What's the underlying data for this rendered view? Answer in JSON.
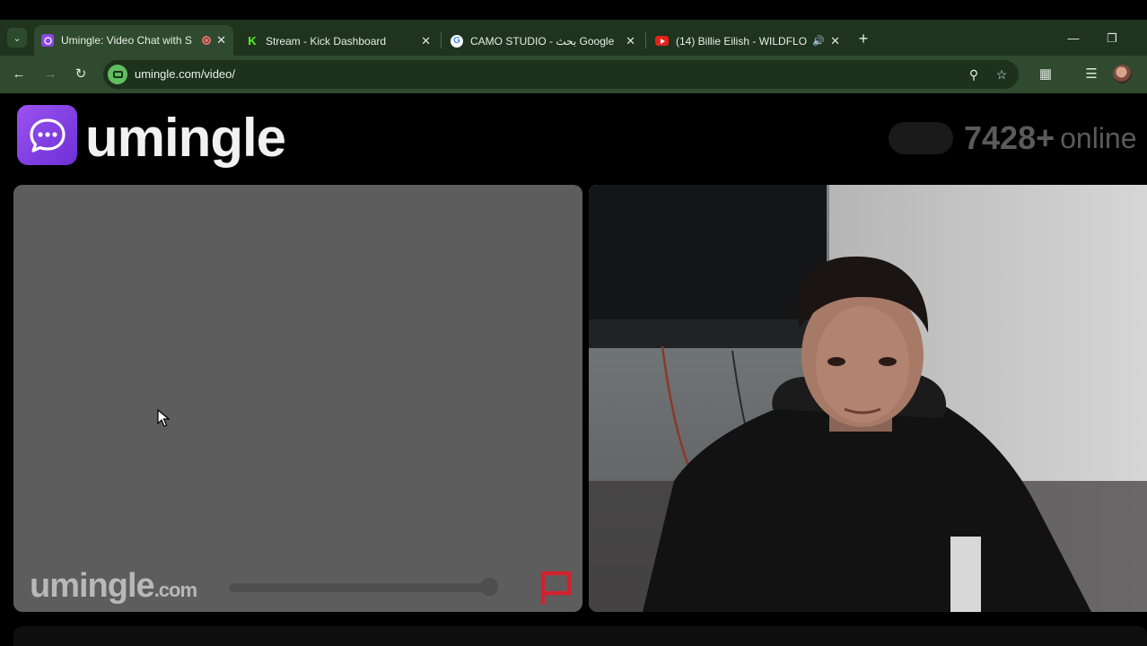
{
  "browser": {
    "tabs": [
      {
        "title": "Umingle: Video Chat with S",
        "active": true,
        "favicon": "umingle-favicon",
        "recording": true
      },
      {
        "title": "Stream - Kick Dashboard",
        "active": false,
        "favicon": "kick-favicon"
      },
      {
        "title": "CAMO STUDIO - بحث Google",
        "active": false,
        "favicon": "google-favicon"
      },
      {
        "title": "(14) Billie Eilish - WILDFLOW",
        "active": false,
        "favicon": "youtube-favicon",
        "audio": true
      }
    ],
    "close_glyph": "✕",
    "new_tab_glyph": "+",
    "address": {
      "url": "umingle.com/video/"
    },
    "accent": "#2f4a2f"
  },
  "site": {
    "logo_text": "umingle",
    "online_count": "7428+",
    "online_label": "online",
    "watermark": "umingle",
    "watermark_suffix": ".com",
    "brand_color": "#8b45ea",
    "report_flag_color": "#d1222f"
  }
}
